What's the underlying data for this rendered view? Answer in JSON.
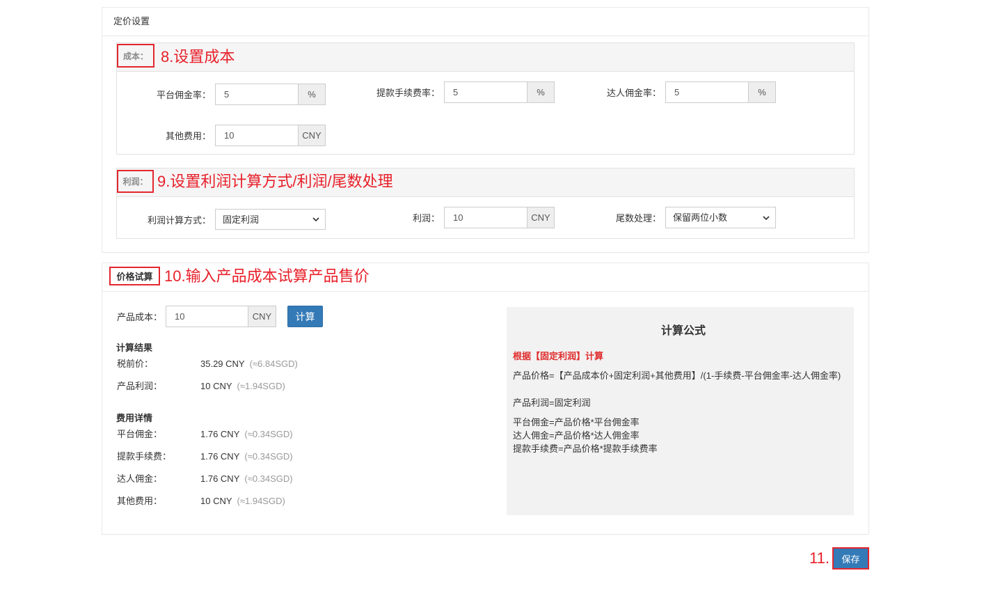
{
  "pricing_panel": {
    "title": "定价设置",
    "cost_section": {
      "label": "成本：",
      "annotation": "8.设置成本",
      "platform_commission": {
        "label": "平台佣金率：",
        "value": "5",
        "unit": "%"
      },
      "withdrawal_fee": {
        "label": "提款手续费率：",
        "value": "5",
        "unit": "%"
      },
      "influencer_commission": {
        "label": "达人佣金率：",
        "value": "5",
        "unit": "%"
      },
      "other_fees": {
        "label": "其他费用：",
        "value": "10",
        "unit": "CNY"
      }
    },
    "profit_section": {
      "label": "利润：",
      "annotation": "9.设置利润计算方式/利润/尾数处理",
      "calc_method": {
        "label": "利润计算方式：",
        "selected": "固定利润"
      },
      "profit": {
        "label": "利润：",
        "value": "10",
        "unit": "CNY"
      },
      "rounding": {
        "label": "尾数处理：",
        "selected": "保留两位小数"
      }
    }
  },
  "trial_panel": {
    "title": "价格试算",
    "annotation": "10.输入产品成本试算产品售价",
    "product_cost": {
      "label": "产品成本：",
      "value": "10",
      "unit": "CNY"
    },
    "calculate_button": "计算",
    "results": {
      "heading": "计算结果",
      "rows": [
        {
          "label": "税前价：",
          "value": "35.29 CNY",
          "converted": "(≈6.84SGD)"
        },
        {
          "label": "产品利润：",
          "value": "10 CNY",
          "converted": "(≈1.94SGD)"
        }
      ]
    },
    "fees": {
      "heading": "费用详情",
      "rows": [
        {
          "label": "平台佣金：",
          "value": "1.76 CNY",
          "converted": "(≈0.34SGD)"
        },
        {
          "label": "提款手续费：",
          "value": "1.76 CNY",
          "converted": "(≈0.34SGD)"
        },
        {
          "label": "达人佣金：",
          "value": "1.76 CNY",
          "converted": "(≈0.34SGD)"
        },
        {
          "label": "其他费用：",
          "value": "10 CNY",
          "converted": "(≈1.94SGD)"
        }
      ]
    },
    "formula": {
      "title": "计算公式",
      "basis": "根据【固定利润】计算",
      "price": "产品价格=【产品成本价+固定利润+其他费用】/(1-手续费-平台佣金率-达人佣金率)",
      "profit": "产品利润=固定利润",
      "lines": [
        "平台佣金=产品价格*平台佣金率",
        "达人佣金=产品价格*达人佣金率",
        "提款手续费=产品价格*提款手续费率"
      ]
    }
  },
  "footer": {
    "annotation": "11.",
    "save_button": "保存"
  },
  "icons": {
    "select_arrow": "chevron-down-icon"
  },
  "colors": {
    "primary": "#337ab7",
    "annotation_red": "#e8202a",
    "formula_bg": "#f2f2f2",
    "section_header_bg": "#f5f5f5"
  }
}
